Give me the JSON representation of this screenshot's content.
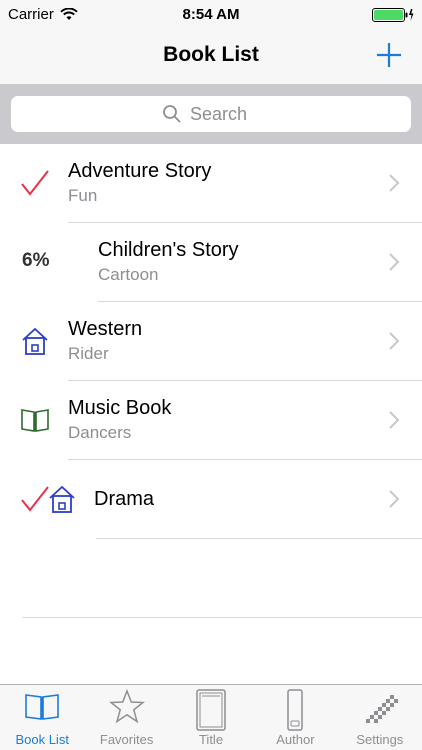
{
  "status_bar": {
    "carrier": "Carrier",
    "time": "8:54 AM"
  },
  "nav": {
    "title": "Book List"
  },
  "search": {
    "placeholder": "Search"
  },
  "books": [
    {
      "title": "Adventure Story",
      "subtitle": "Fun",
      "icon": "checkmark-icon"
    },
    {
      "title": "Children's Story",
      "subtitle": "Cartoon",
      "icon": "progress-percent",
      "badge": "6%"
    },
    {
      "title": "Western",
      "subtitle": "Rider",
      "icon": "house-icon"
    },
    {
      "title": "Music Book",
      "subtitle": "Dancers",
      "icon": "open-book-icon"
    },
    {
      "title": "Drama",
      "subtitle": "",
      "icon": "checkmark-house-icon"
    }
  ],
  "tabs": [
    {
      "label": "Book List",
      "icon": "open-book-icon",
      "active": true
    },
    {
      "label": "Favorites",
      "icon": "star-icon",
      "active": false
    },
    {
      "label": "Title",
      "icon": "book-cover-icon",
      "active": false
    },
    {
      "label": "Author",
      "icon": "phone-icon",
      "active": false
    },
    {
      "label": "Settings",
      "icon": "checker-icon",
      "active": false
    }
  ],
  "colors": {
    "accent": "#1a7dd8",
    "check": "#e8304a",
    "house": "#2e3fc7",
    "book": "#2f6b2f",
    "muted": "#8e8e93"
  }
}
